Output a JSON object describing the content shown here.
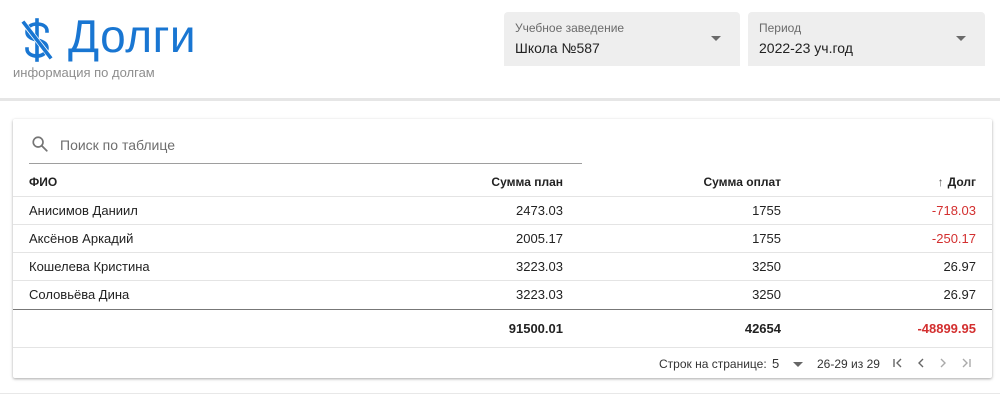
{
  "header": {
    "title": "Долги",
    "subtitle": "информация по долгам",
    "logo_icon": "dollar-off-icon",
    "accent_color": "#1976d2"
  },
  "filters": {
    "school": {
      "label": "Учебное заведение",
      "value": "Школа №587"
    },
    "period": {
      "label": "Период",
      "value": "2022-23 уч.год"
    }
  },
  "table": {
    "search_placeholder": "Поиск по таблице",
    "columns": {
      "fio": "ФИО",
      "plan": "Сумма план",
      "paid": "Сумма оплат",
      "debt": "Долг"
    },
    "sorted_column": "debt",
    "sort_direction": "asc",
    "rows": [
      {
        "fio": "Анисимов Даниил",
        "plan": "2473.03",
        "paid": "1755",
        "debt": "-718.03"
      },
      {
        "fio": "Аксёнов Аркадий",
        "plan": "2005.17",
        "paid": "1755",
        "debt": "-250.17"
      },
      {
        "fio": "Кошелева Кристина",
        "plan": "3223.03",
        "paid": "3250",
        "debt": "26.97"
      },
      {
        "fio": "Соловьёва Дина",
        "plan": "3223.03",
        "paid": "3250",
        "debt": "26.97"
      }
    ],
    "totals": {
      "plan": "91500.01",
      "paid": "42654",
      "debt": "-48899.95"
    },
    "negative_color": "#d32f2f"
  },
  "pagination": {
    "rows_per_page_label": "Строк на странице:",
    "rows_per_page": "5",
    "range": "26-29 из 29"
  }
}
